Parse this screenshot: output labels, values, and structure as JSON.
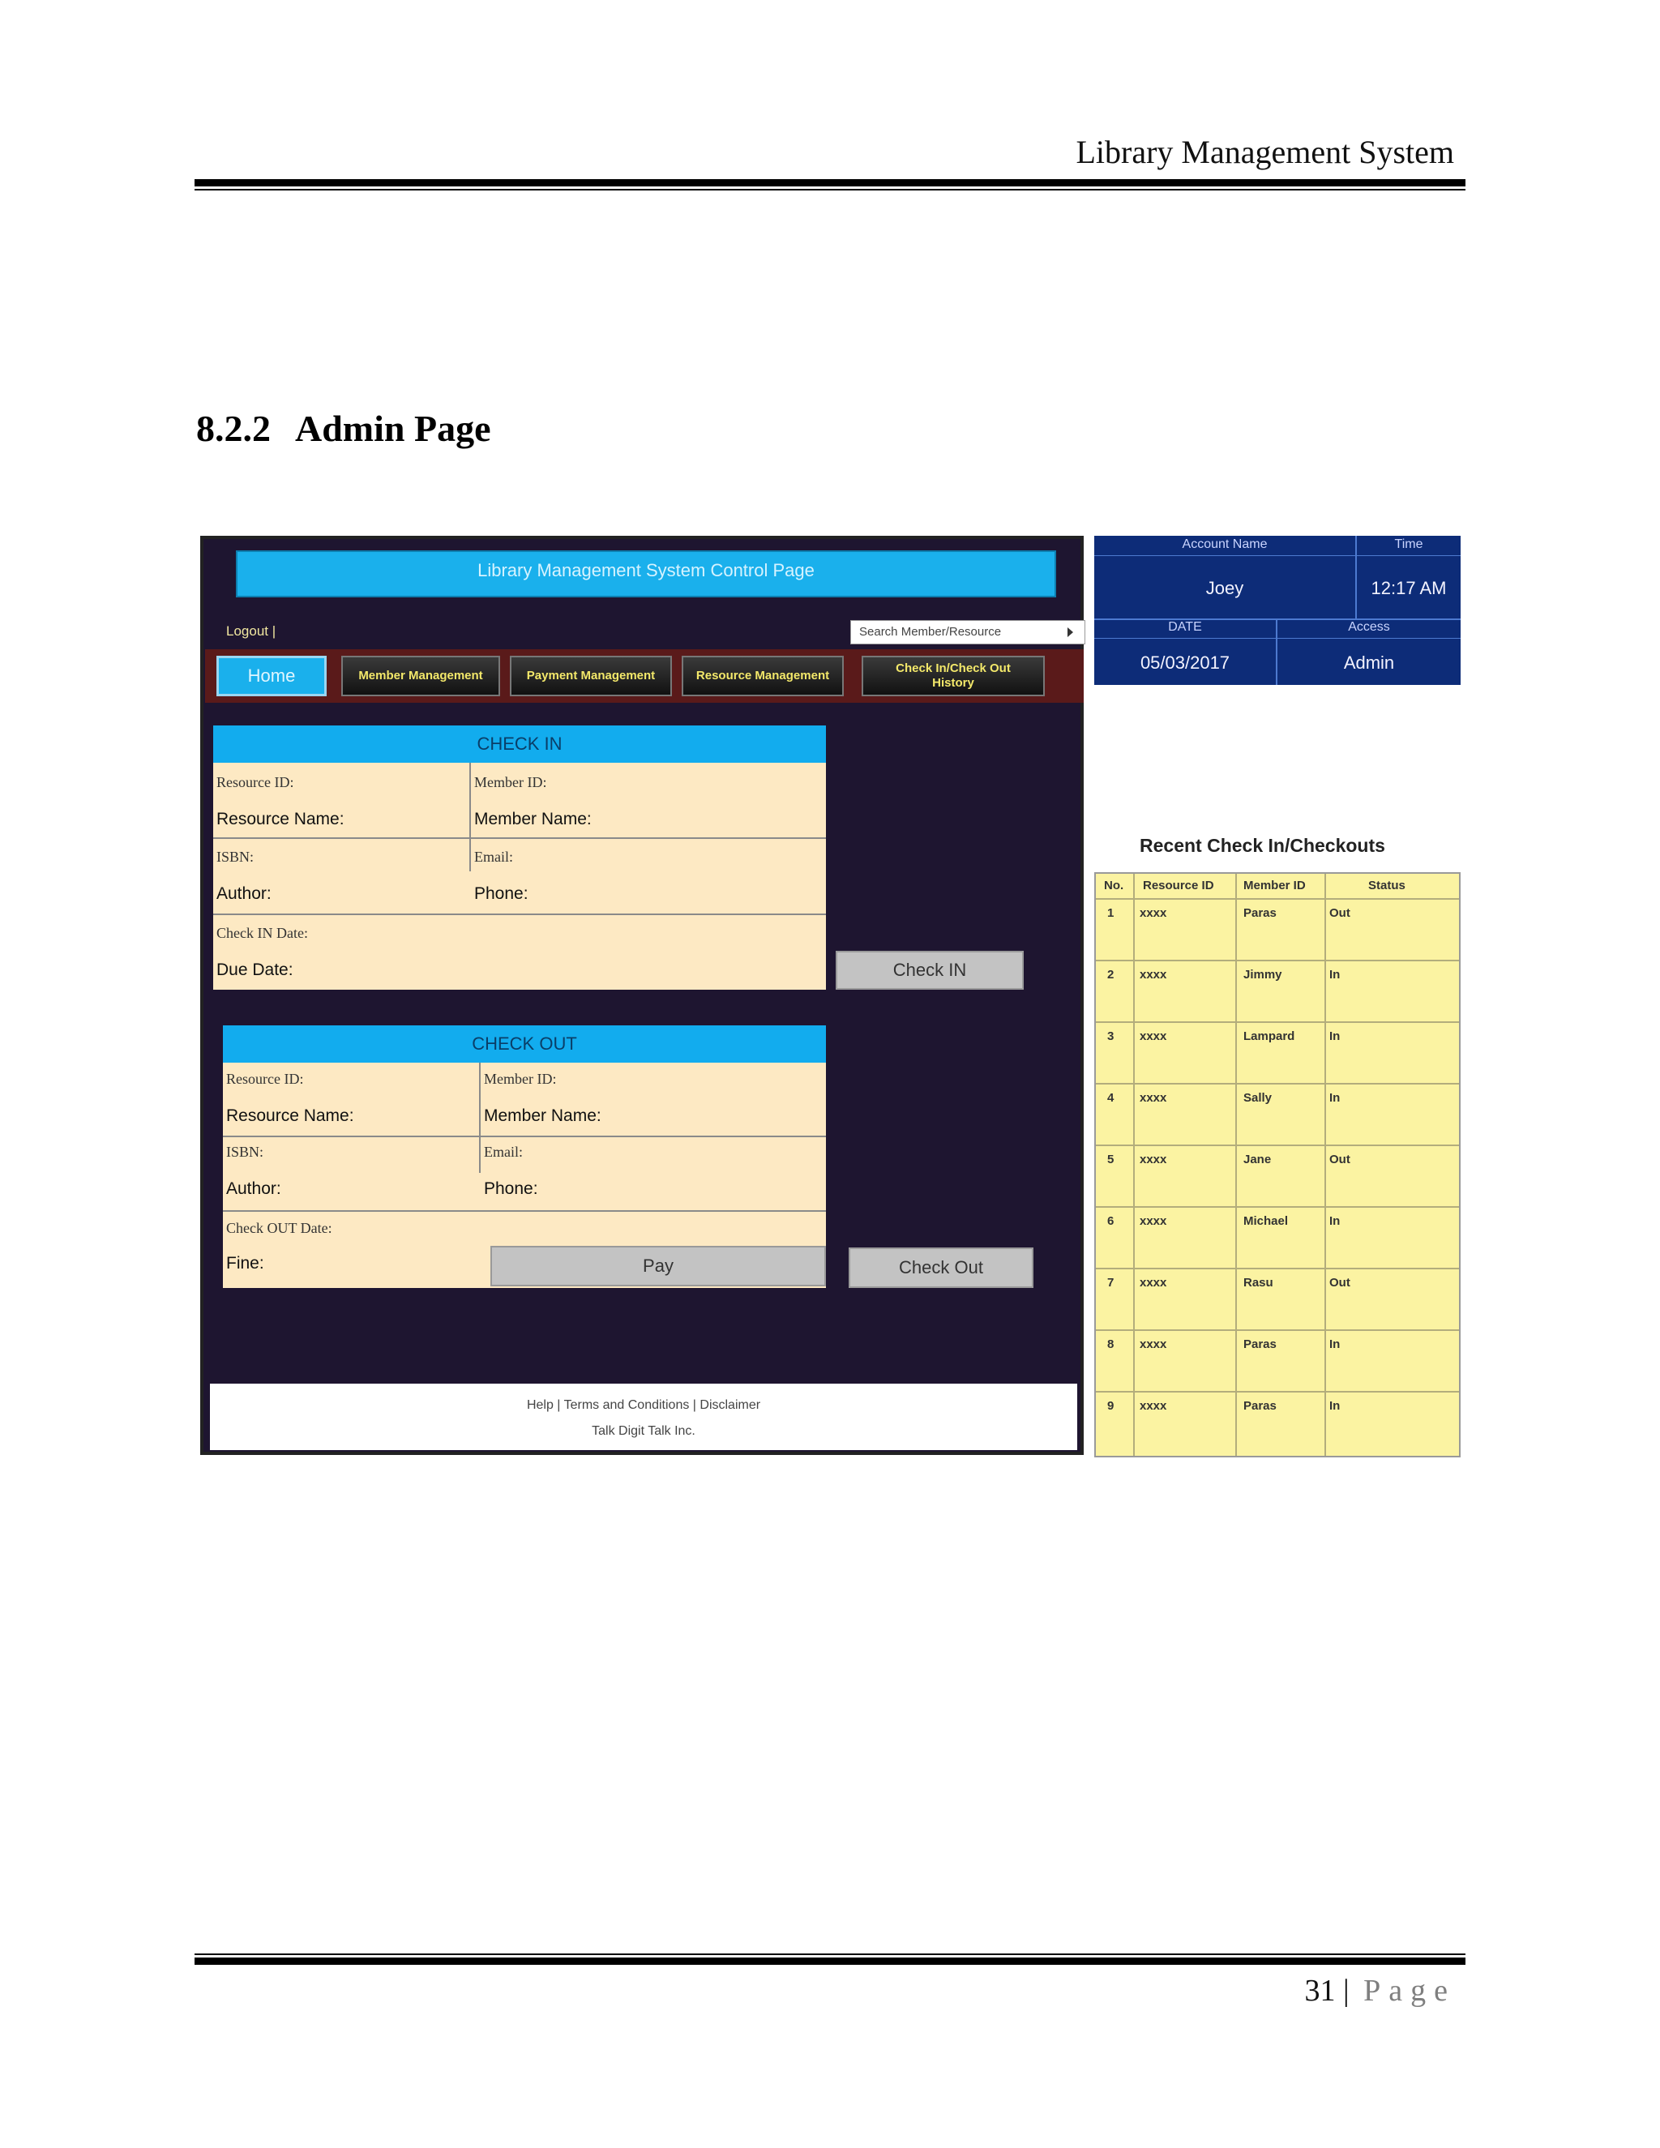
{
  "document": {
    "header_title": "Library Management System",
    "section_number": "8.2.2",
    "section_title": "Admin Page",
    "page_number": "31",
    "page_separator": "|",
    "page_word": "Page"
  },
  "app": {
    "title": "Library Management System Control Page",
    "logout_label": "Logout |",
    "search_placeholder": "Search Member/Resource",
    "nav": {
      "home": "Home",
      "member_management": "Member Management",
      "payment_management": "Payment Management",
      "resource_management": "Resource Management",
      "history_line1": "Check In/Check Out",
      "history_line2": "History"
    },
    "check_in": {
      "heading": "CHECK IN",
      "resource_id": "Resource ID:",
      "member_id": "Member ID:",
      "resource_name": "Resource Name:",
      "member_name": "Member Name:",
      "isbn": "ISBN:",
      "email": "Email:",
      "author": "Author:",
      "phone": "Phone:",
      "check_in_date": "Check IN Date:",
      "due_date": "Due Date:",
      "button": "Check IN"
    },
    "check_out": {
      "heading": "CHECK OUT",
      "resource_id": "Resource ID:",
      "member_id": "Member ID:",
      "resource_name": "Resource Name:",
      "member_name": "Member Name:",
      "isbn": "ISBN:",
      "email": "Email:",
      "author": "Author:",
      "phone": "Phone:",
      "check_out_date": "Check OUT  Date:",
      "fine": "Fine:",
      "pay_button": "Pay",
      "button": "Check Out"
    },
    "footer": {
      "links": "Help | Terms and Conditions | Disclaimer",
      "company": "Talk Digit Talk Inc."
    }
  },
  "account": {
    "account_name_label": "Account Name",
    "account_name": "Joey",
    "time_label": "Time",
    "time": "12:17 AM",
    "date_label": "DATE",
    "date": "05/03/2017",
    "access_label": "Access",
    "access": "Admin"
  },
  "recent": {
    "title": "Recent Check In/Checkouts",
    "headers": [
      "No.",
      "Resource ID",
      "Member ID",
      "Status"
    ],
    "rows": [
      [
        "1",
        "xxxx",
        "Paras",
        "Out"
      ],
      [
        "2",
        "xxxx",
        "Jimmy",
        "In"
      ],
      [
        "3",
        "xxxx",
        "Lampard",
        "In"
      ],
      [
        "4",
        "xxxx",
        "Sally",
        "In"
      ],
      [
        "5",
        "xxxx",
        "Jane",
        "Out"
      ],
      [
        "6",
        "xxxx",
        "Michael",
        "In"
      ],
      [
        "7",
        "xxxx",
        "Rasu",
        "Out"
      ],
      [
        "8",
        "xxxx",
        "Paras",
        "In"
      ],
      [
        "9",
        "xxxx",
        "Paras",
        "In"
      ]
    ]
  },
  "colors": {
    "app_background": "#1e1530",
    "accent_blue": "#1ab0ec",
    "nav_strip": "#5a1a1a",
    "form_panel": "#fde9c3",
    "account_panel": "#0d2c78",
    "recent_table": "#fbf3a2"
  }
}
